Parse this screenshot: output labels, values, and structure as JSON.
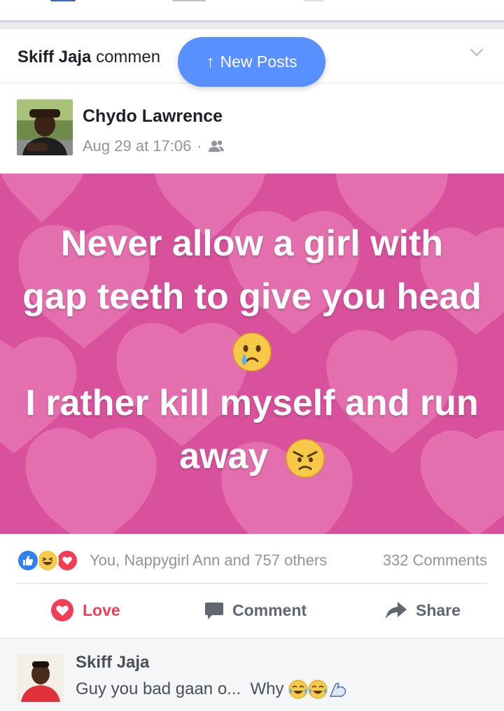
{
  "story": {
    "actor": "Skiff Jaja",
    "action_text": "commen",
    "new_posts_label": "New Posts"
  },
  "post": {
    "author": "Chydo Lawrence",
    "time": "Aug 29 at 17:06",
    "privacy_icon": "friends-icon",
    "text_lines": [
      "Never allow a girl with",
      "gap teeth to give you head",
      "I rather kill myself and run",
      "away"
    ],
    "background_color": "#d9519c"
  },
  "reactions": {
    "icons": [
      "like-icon",
      "haha-icon",
      "love-icon"
    ],
    "names": "You, Nappygirl Ann and 757 others",
    "comments": "332 Comments"
  },
  "actions": {
    "love": "Love",
    "comment": "Comment",
    "share": "Share"
  },
  "comment": {
    "author": "Skiff Jaja",
    "text": "Guy you bad gaan o...  Why"
  },
  "colors": {
    "accent": "#5890ff",
    "love": "#f33e58",
    "like": "#2f80f2",
    "muted": "#90949c"
  }
}
